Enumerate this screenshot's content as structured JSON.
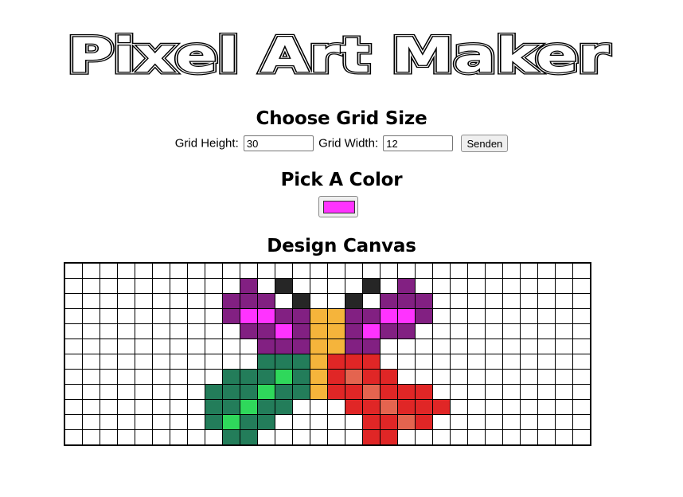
{
  "logo": {
    "text": "Pixel Art Maker"
  },
  "grid_size": {
    "heading": "Choose Grid Size",
    "height_label": "Grid Height:",
    "height_value": "30",
    "width_label": "Grid Width:",
    "width_value": "12",
    "submit_label": "Senden"
  },
  "color_picker": {
    "heading": "Pick A Color",
    "value": "#ff33ff"
  },
  "canvas": {
    "heading": "Design Canvas",
    "rows": 12,
    "cols": 30,
    "palette": {
      "0": "#ffffff",
      "P": "#822082",
      "M": "#ff33ff",
      "K": "#262626",
      "Y": "#f5b43b",
      "G": "#237d5a",
      "L": "#2fd85b",
      "R": "#e02626",
      "S": "#e4644f"
    },
    "pixels": [
      "000000000000000000000000000000",
      "0000000000P0K0000K0P0000000000",
      "000000000PPP0K00K0PPP000000000",
      "000000000PMMPPYYPPMMP000000000",
      "0000000000PPMPYYPMPP0000000000",
      "00000000000PPPYYPP000000000000",
      "00000000000GGGYRRR000000000000",
      "000000000GGGLGYRSRR00000000000",
      "00000000GGGLGGYRRSRRR000000000",
      "00000000GGLGG000RRSRRR00000000",
      "00000000GLGG00000RRSR000000000",
      "000000000GG000000RR00000000000"
    ]
  }
}
